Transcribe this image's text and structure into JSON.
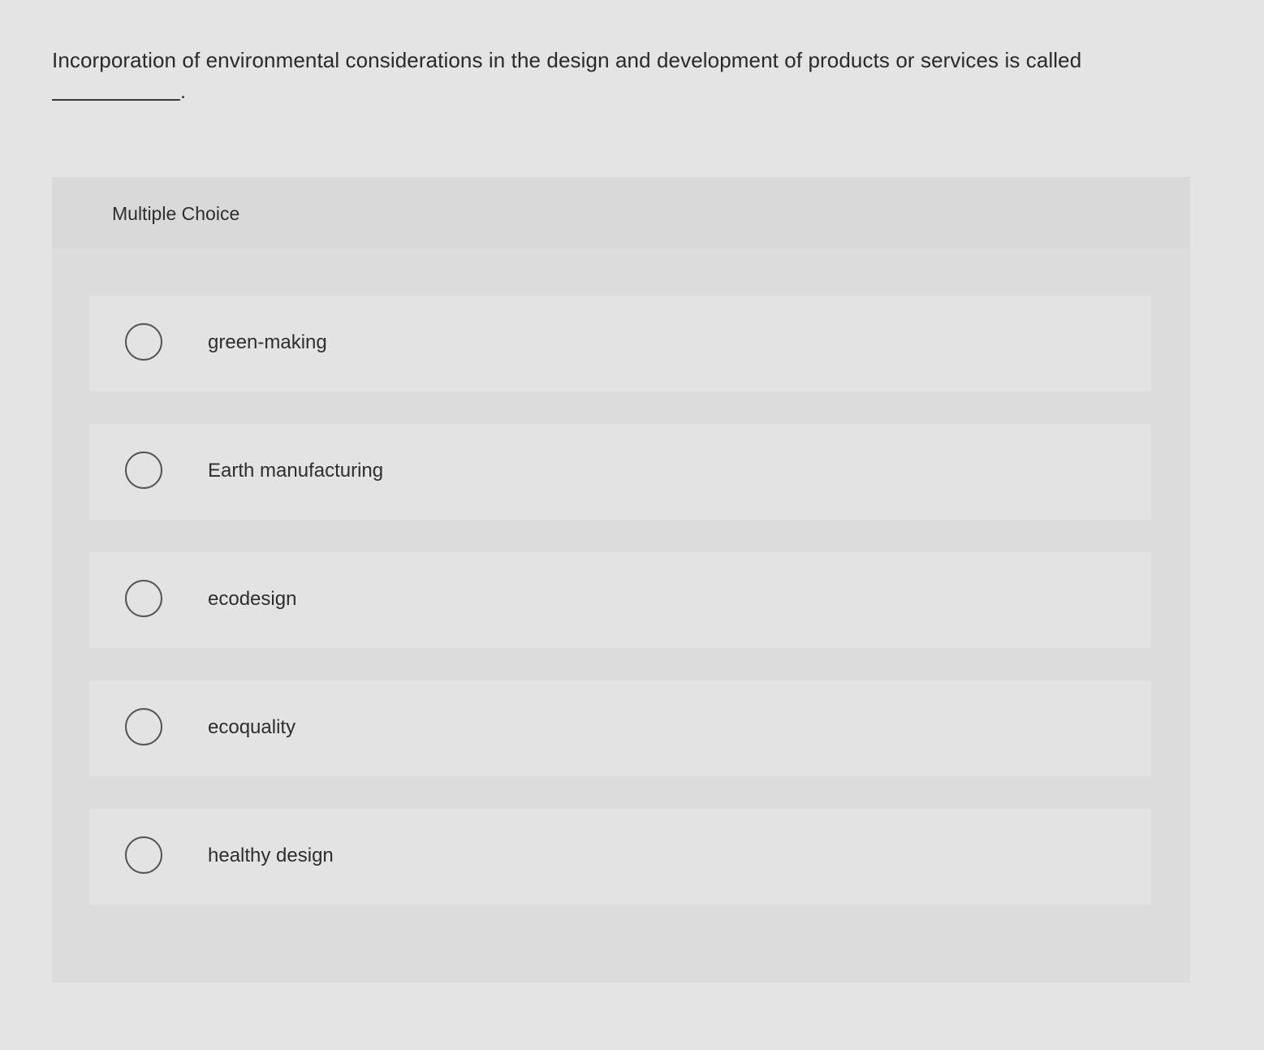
{
  "question": {
    "text": "Incorporation of environmental considerations in the design and development of products or services is called"
  },
  "multiple_choice": {
    "title": "Multiple Choice",
    "options": [
      {
        "label": "green-making"
      },
      {
        "label": "Earth manufacturing"
      },
      {
        "label": "ecodesign"
      },
      {
        "label": "ecoquality"
      },
      {
        "label": "healthy design"
      }
    ]
  },
  "colors": {
    "page_background": "#e4e4e4",
    "panel_background": "#dcdcdc",
    "option_background": "#e3e3e3",
    "radio_border": "#555555",
    "text": "#2e2e2e"
  }
}
